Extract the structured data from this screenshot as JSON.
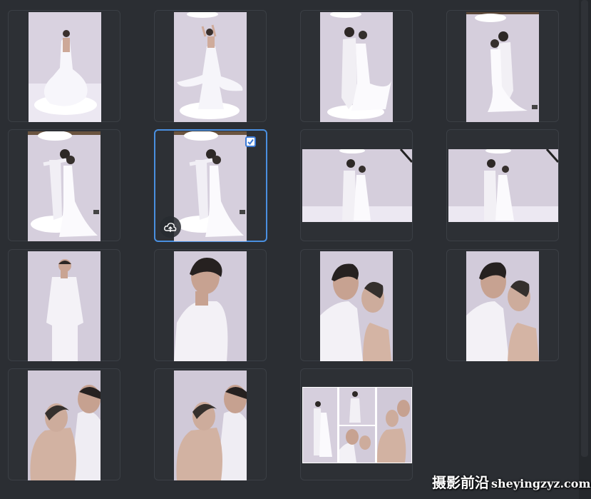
{
  "gallery": {
    "tiles": [
      {
        "id": 1,
        "orientation": "portrait",
        "scene": "bride-back-twirl"
      },
      {
        "id": 2,
        "orientation": "portrait",
        "scene": "bride-twirl-arms-up"
      },
      {
        "id": 3,
        "orientation": "portrait",
        "scene": "couple-embrace"
      },
      {
        "id": 4,
        "orientation": "portrait",
        "scene": "couple-embrace"
      },
      {
        "id": 5,
        "orientation": "portrait",
        "scene": "couple-dance"
      },
      {
        "id": 6,
        "orientation": "portrait",
        "scene": "couple-dance",
        "selected": true,
        "checked": true,
        "upload_icon": "cloud-upload-icon"
      },
      {
        "id": 7,
        "orientation": "landscape",
        "scene": "couple-wide"
      },
      {
        "id": 8,
        "orientation": "landscape",
        "scene": "couple-wide"
      },
      {
        "id": 9,
        "orientation": "portrait",
        "scene": "groom-standing"
      },
      {
        "id": 10,
        "orientation": "portrait",
        "scene": "groom-closeup"
      },
      {
        "id": 11,
        "orientation": "portrait",
        "scene": "couple-kiss-closeup"
      },
      {
        "id": 12,
        "orientation": "portrait",
        "scene": "couple-kiss-closeup"
      },
      {
        "id": 13,
        "orientation": "portrait",
        "scene": "couple-cheek"
      },
      {
        "id": 14,
        "orientation": "portrait",
        "scene": "couple-cheek"
      },
      {
        "id": 15,
        "orientation": "collage",
        "scene": "collage-five"
      }
    ]
  },
  "watermark": {
    "text_cn": "摄影前沿",
    "text_en": "sheyingzyz.com"
  },
  "colors": {
    "background": "#2b2e33",
    "tile_border": "#3b3f45",
    "selected_border": "#4a8fe0",
    "checkbox": "#3c7ad6"
  }
}
